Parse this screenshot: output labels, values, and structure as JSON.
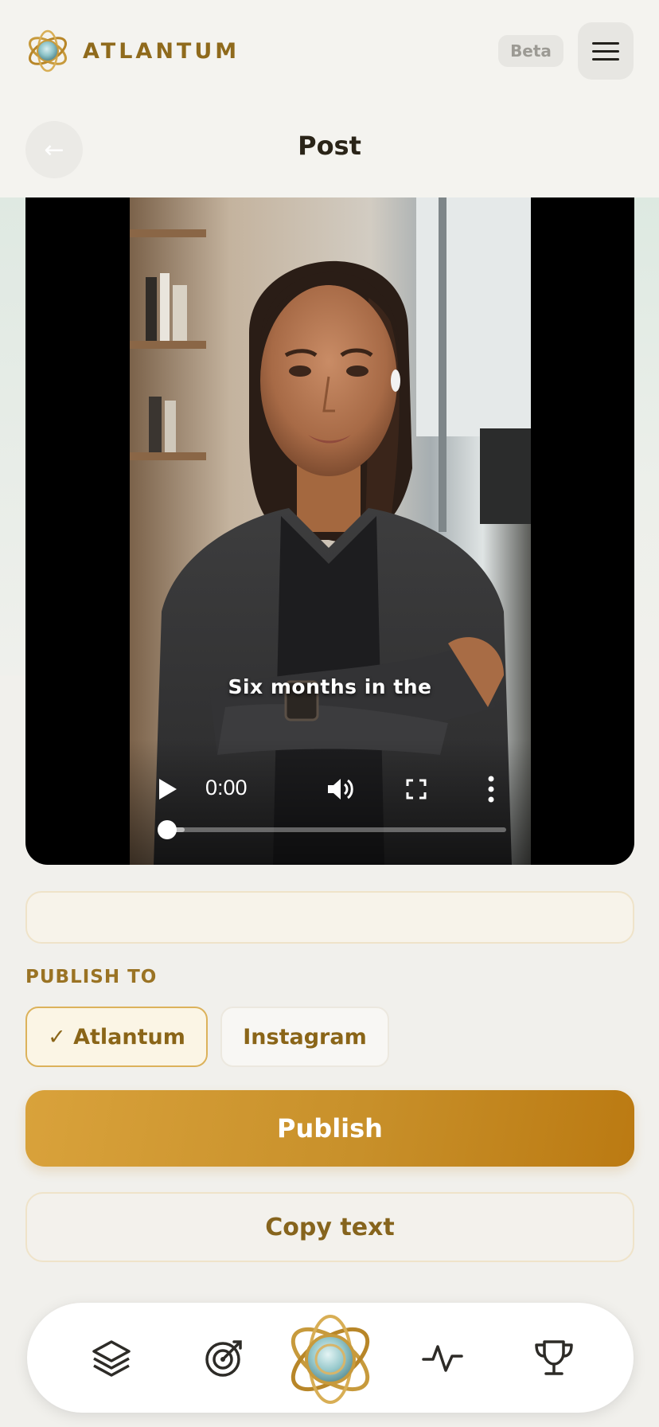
{
  "header": {
    "brand_name": "ATLANTUM",
    "beta_label": "Beta",
    "page_title": "Post",
    "back_icon": "arrow-left-icon",
    "menu_icon": "hamburger-menu-icon"
  },
  "video": {
    "caption": "Six months in the",
    "current_time": "0:00",
    "progress_fraction": 0.06,
    "controls": [
      "play-icon",
      "volume-icon",
      "fullscreen-icon",
      "more-vertical-icon"
    ]
  },
  "post_text_value": "",
  "publish_to": {
    "label": "PUBLISH TO",
    "options": [
      {
        "label": "✓ Atlantum",
        "selected": true
      },
      {
        "label": "Instagram",
        "selected": false
      }
    ]
  },
  "actions": {
    "publish_label": "Publish",
    "copy_label": "Copy text"
  },
  "bottom_nav": {
    "items": [
      "layers-icon",
      "target-icon",
      "atlantum-orb-icon",
      "activity-icon",
      "trophy-icon"
    ]
  },
  "colors": {
    "accent_gold": "#c8902a",
    "brand_text": "#8f6a1c",
    "background": "#f1f0ec"
  }
}
